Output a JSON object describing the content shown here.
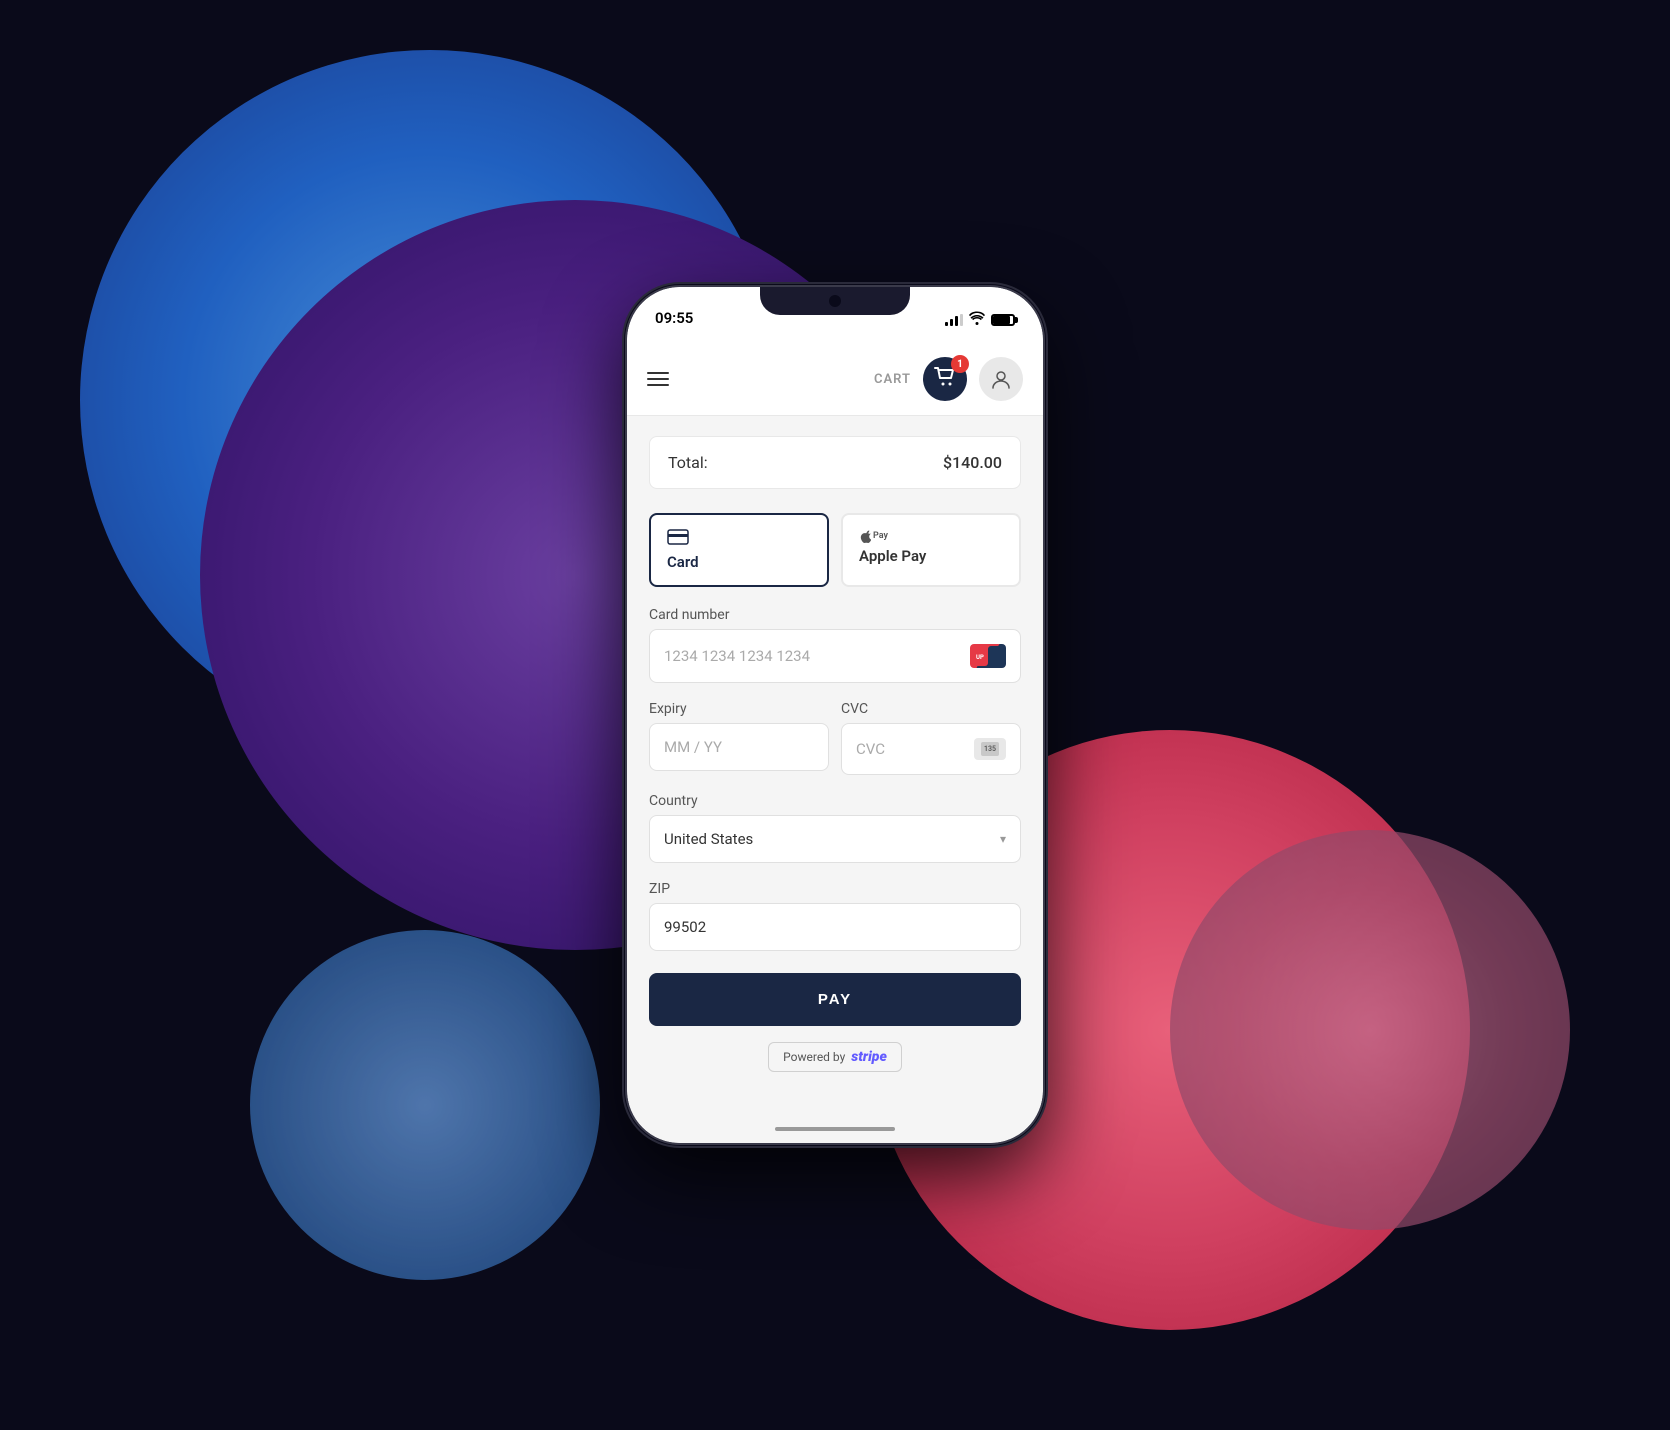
{
  "background": {
    "color": "#0a0a1a"
  },
  "phone": {
    "status_bar": {
      "time": "09:55",
      "signal_bars": 3,
      "wifi": true,
      "battery_level": 85
    },
    "header": {
      "cart_label": "CART",
      "cart_count": "1",
      "menu_icon": "hamburger-icon",
      "user_icon": "user-icon"
    },
    "payment": {
      "total_label": "Total:",
      "total_amount": "$140.00",
      "tabs": [
        {
          "id": "card",
          "label": "Card",
          "icon": "credit-card",
          "active": true
        },
        {
          "id": "apple-pay",
          "label": "Apple Pay",
          "icon": "apple-pay",
          "active": false
        }
      ],
      "fields": {
        "card_number": {
          "label": "Card number",
          "placeholder": "1234 1234 1234 1234"
        },
        "expiry": {
          "label": "Expiry",
          "placeholder": "MM / YY"
        },
        "cvc": {
          "label": "CVC",
          "placeholder": "CVC"
        },
        "country": {
          "label": "Country",
          "value": "United States"
        },
        "zip": {
          "label": "ZIP",
          "value": "99502"
        }
      },
      "pay_button": "PAY",
      "stripe_label": "Powered by",
      "stripe_brand": "stripe"
    }
  }
}
